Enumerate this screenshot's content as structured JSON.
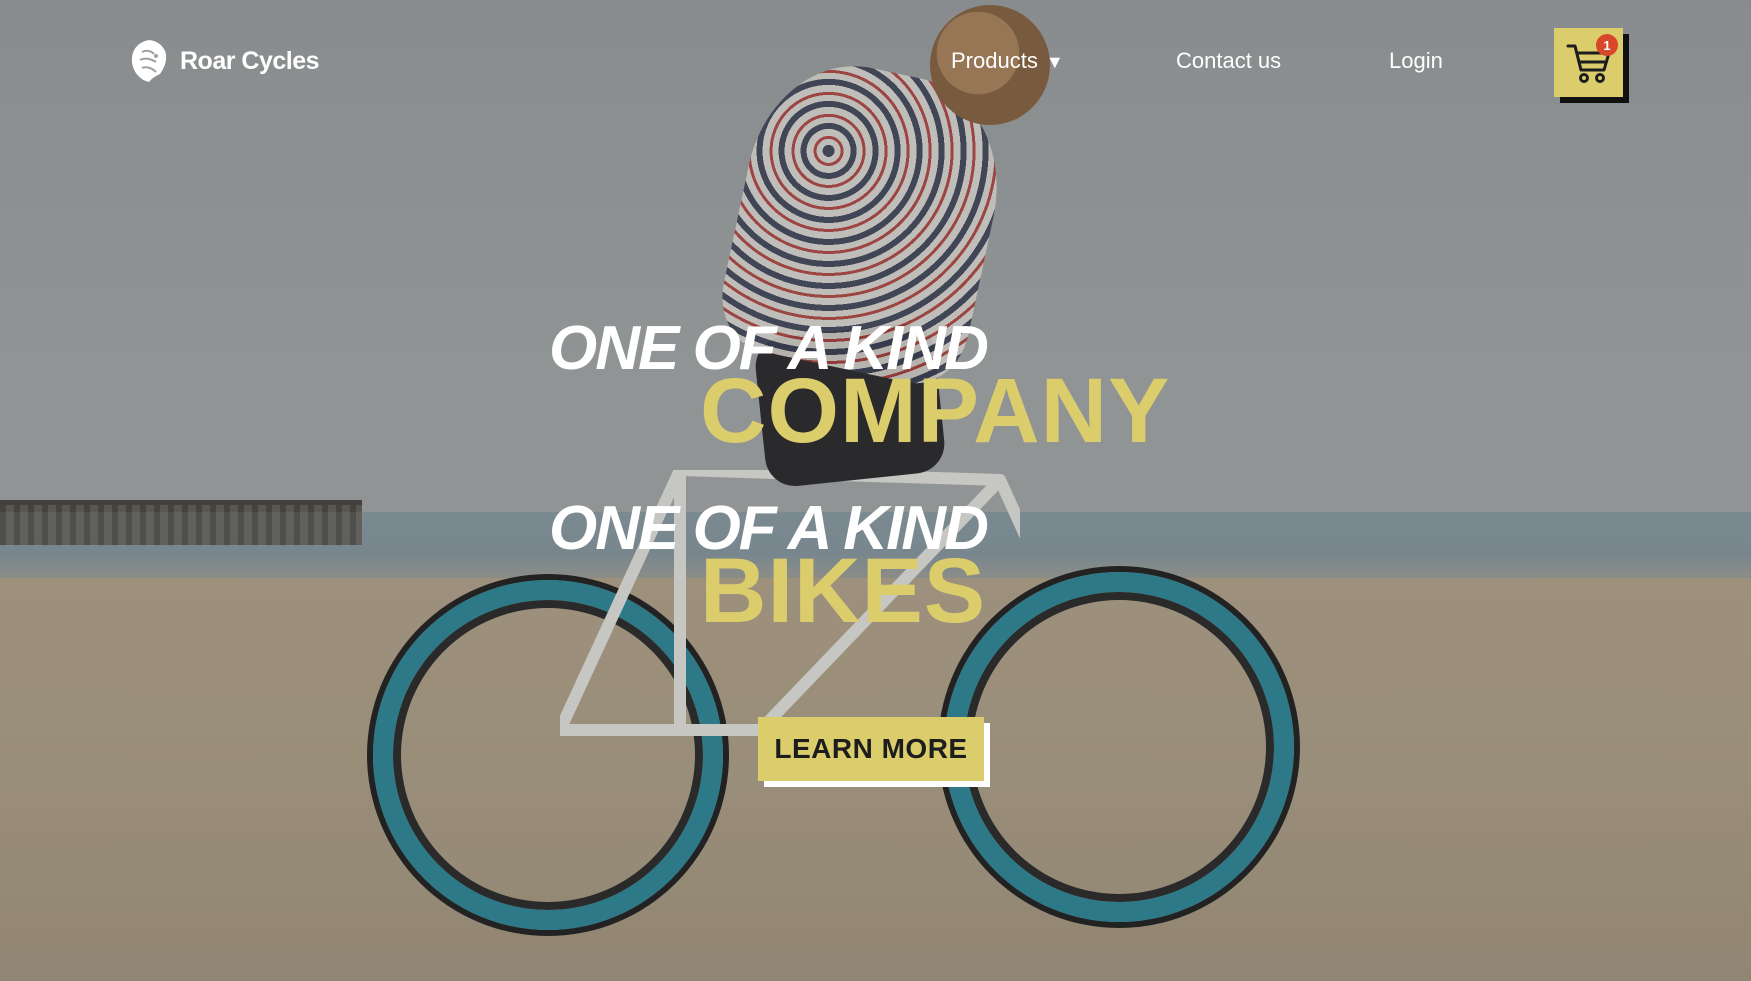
{
  "brand": {
    "name": "Roar Cycles",
    "logo_icon": "lion-head-icon"
  },
  "nav": {
    "products_label": "Products",
    "products_icon": "caret-down-icon",
    "contact_label": "Contact us",
    "login_label": "Login"
  },
  "cart": {
    "icon": "shopping-cart-icon",
    "count": "1"
  },
  "hero": {
    "line1_kicker": "ONE OF A KIND",
    "line1_highlight": "COMPANY",
    "line2_kicker": "ONE OF A KIND",
    "line2_highlight": "BIKES",
    "cta_label": "LEARN MORE"
  },
  "colors": {
    "accent": "#dccd6c",
    "badge": "#d9472b",
    "text": "#ffffff"
  }
}
